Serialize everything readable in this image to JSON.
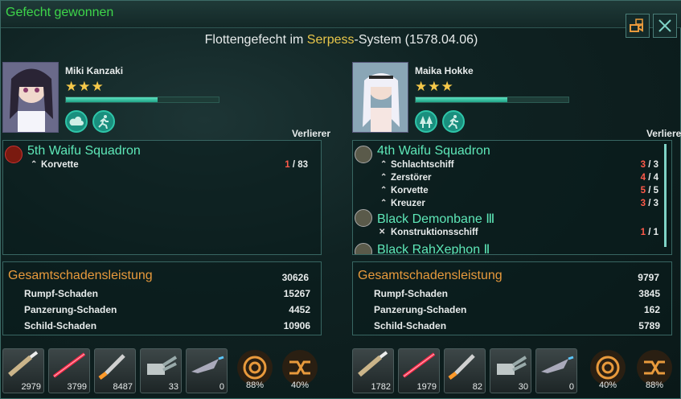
{
  "window": {
    "title": "Gefecht gewonnen"
  },
  "header": {
    "prefix": "Flottengefecht im ",
    "system": "Serpess",
    "suffix": "-System (1578.04.06)"
  },
  "left": {
    "name": "Miki Kanzaki",
    "stars": "★★★",
    "xp_fraction": 0.6,
    "result": "Verlierer",
    "fleets": [
      {
        "name": "5th Waifu Squadron",
        "ships": [
          {
            "type": "Korvette",
            "lost": "1",
            "total": "/ 83"
          }
        ]
      }
    ],
    "damage": {
      "title": "Gesamtschadensleistung",
      "total": "30626",
      "rows": [
        {
          "label": "Rumpf-Schaden",
          "value": "15267"
        },
        {
          "label": "Panzerung-Schaden",
          "value": "4452"
        },
        {
          "label": "Schild-Schaden",
          "value": "10906"
        }
      ]
    },
    "weapons": [
      "2979",
      "3799",
      "8487",
      "33",
      "0"
    ],
    "stats": [
      "88%",
      "40%"
    ]
  },
  "right": {
    "name": "Maika Hokke",
    "stars": "★★★",
    "xp_fraction": 0.6,
    "result": "Verlierer",
    "fleets": [
      {
        "name": "4th Waifu Squadron",
        "ships": [
          {
            "type": "Schlachtschiff",
            "lost": "3",
            "total": "/ 3"
          },
          {
            "type": "Zerstörer",
            "lost": "4",
            "total": "/ 4"
          },
          {
            "type": "Korvette",
            "lost": "5",
            "total": "/ 5"
          },
          {
            "type": "Kreuzer",
            "lost": "3",
            "total": "/ 3"
          }
        ]
      },
      {
        "name": "Black Demonbane Ⅲ",
        "ships": [
          {
            "type": "Konstruktionsschiff",
            "lost": "1",
            "total": "/ 1"
          }
        ]
      },
      {
        "name": "Black RahXephon Ⅱ",
        "ships": []
      }
    ],
    "damage": {
      "title": "Gesamtschadensleistung",
      "total": "9797",
      "rows": [
        {
          "label": "Rumpf-Schaden",
          "value": "3845"
        },
        {
          "label": "Panzerung-Schaden",
          "value": "162"
        },
        {
          "label": "Schild-Schaden",
          "value": "5789"
        }
      ]
    },
    "weapons": [
      "1782",
      "1979",
      "82",
      "30",
      "0"
    ],
    "stats": [
      "40%",
      "88%"
    ]
  }
}
